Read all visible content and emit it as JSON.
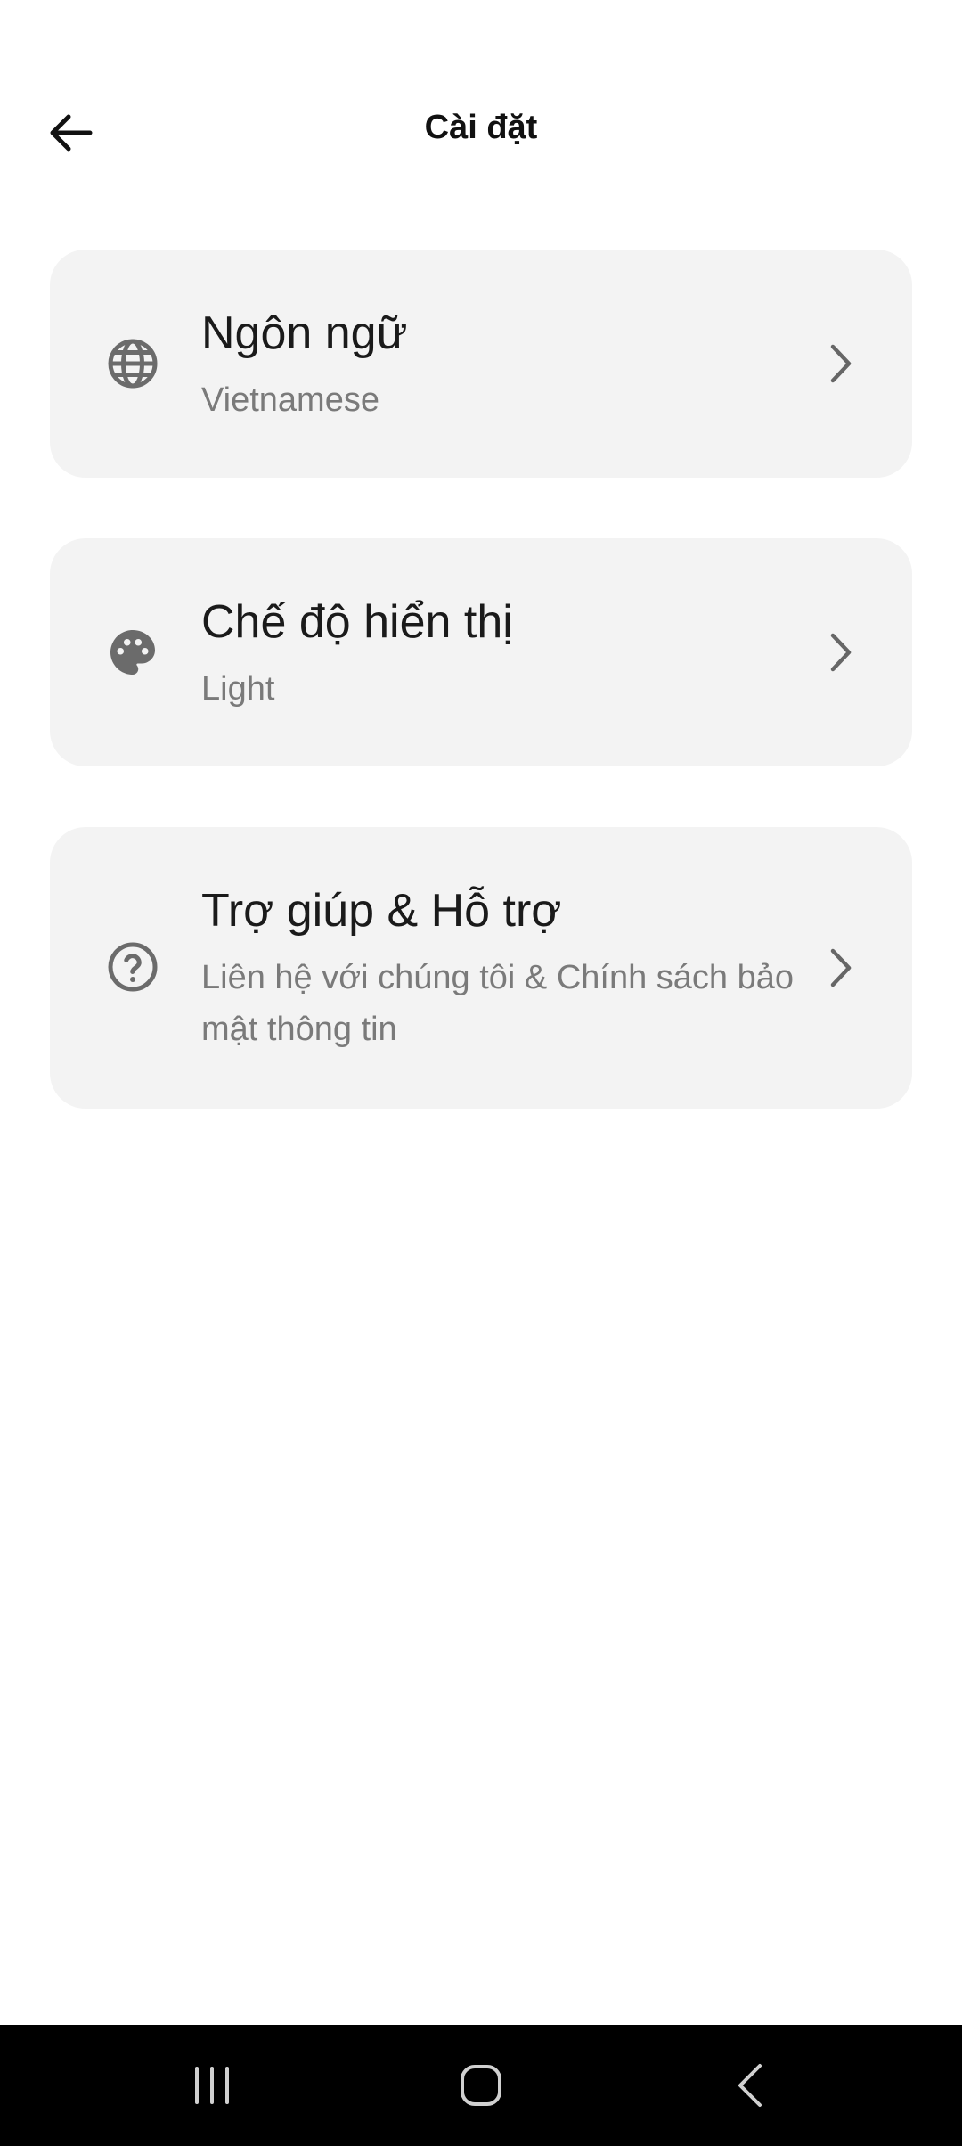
{
  "header": {
    "title": "Cài đặt",
    "back_icon": "arrow-left-icon"
  },
  "settings": [
    {
      "title": "Ngôn ngữ",
      "subtitle": "Vietnamese",
      "icon": "globe-icon"
    },
    {
      "title": "Chế độ hiển thị",
      "subtitle": "Light",
      "icon": "palette-icon"
    },
    {
      "title": "Trợ giúp & Hỗ trợ",
      "subtitle": "Liên hệ với chúng tôi & Chính sách bảo mật thông tin",
      "icon": "help-circle-icon"
    }
  ],
  "navbar": {
    "icons": [
      "recent-apps-icon",
      "home-icon",
      "back-icon"
    ]
  },
  "colors": {
    "card_bg": "#f3f3f3",
    "icon_gray": "#6b6b6b",
    "title_text": "#1a1a1a",
    "subtitle_text": "#7a7a7a",
    "navbar_bg": "#000000"
  }
}
